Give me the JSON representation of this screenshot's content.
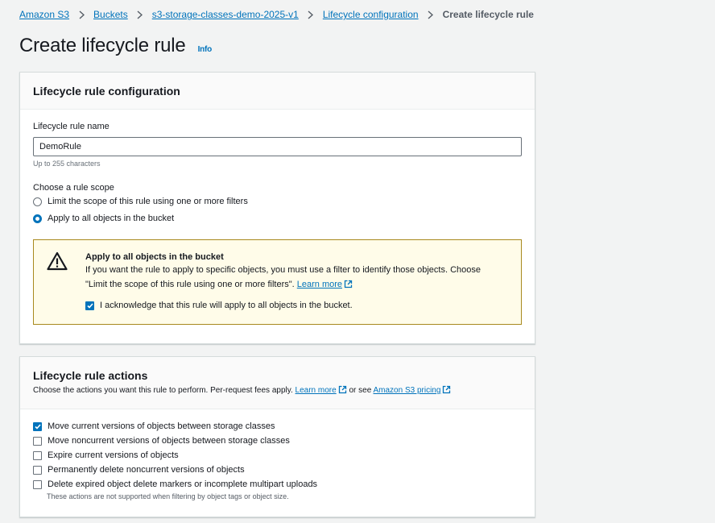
{
  "breadcrumb": {
    "items": [
      "Amazon S3",
      "Buckets",
      "s3-storage-classes-demo-2025-v1",
      "Lifecycle configuration"
    ],
    "current": "Create lifecycle rule"
  },
  "page": {
    "title": "Create lifecycle rule",
    "info_label": "Info"
  },
  "config_panel": {
    "title": "Lifecycle rule configuration",
    "name_label": "Lifecycle rule name",
    "name_value": "DemoRule",
    "name_hint": "Up to 255 characters",
    "scope_label": "Choose a rule scope",
    "scope_options": [
      {
        "label": "Limit the scope of this rule using one or more filters",
        "checked": false
      },
      {
        "label": "Apply to all objects in the bucket",
        "checked": true
      }
    ],
    "alert": {
      "icon": "warning-icon",
      "title": "Apply to all objects in the bucket",
      "text_line1": "If you want the rule to apply to specific objects, you must use a filter to identify those objects. Choose",
      "text_line2": "\"Limit the scope of this rule using one or more filters\".",
      "learn_more": "Learn more",
      "ack_label": "I acknowledge that this rule will apply to all objects in the bucket.",
      "ack_checked": true
    }
  },
  "actions_panel": {
    "title": "Lifecycle rule actions",
    "desc_prefix": "Choose the actions you want this rule to perform. Per-request fees apply.",
    "learn_more": "Learn more",
    "or_see": "or see",
    "pricing_link": "Amazon S3 pricing",
    "actions": [
      {
        "label": "Move current versions of objects between storage classes",
        "checked": true
      },
      {
        "label": "Move noncurrent versions of objects between storage classes",
        "checked": false
      },
      {
        "label": "Expire current versions of objects",
        "checked": false
      },
      {
        "label": "Permanently delete noncurrent versions of objects",
        "checked": false
      },
      {
        "label": "Delete expired object delete markers or incomplete multipart uploads",
        "checked": false
      }
    ],
    "note": "These actions are not supported when filtering by object tags or object size."
  },
  "colors": {
    "link": "#0073bb",
    "warning_bg": "#fffce9",
    "warning_border": "#a8891e"
  }
}
